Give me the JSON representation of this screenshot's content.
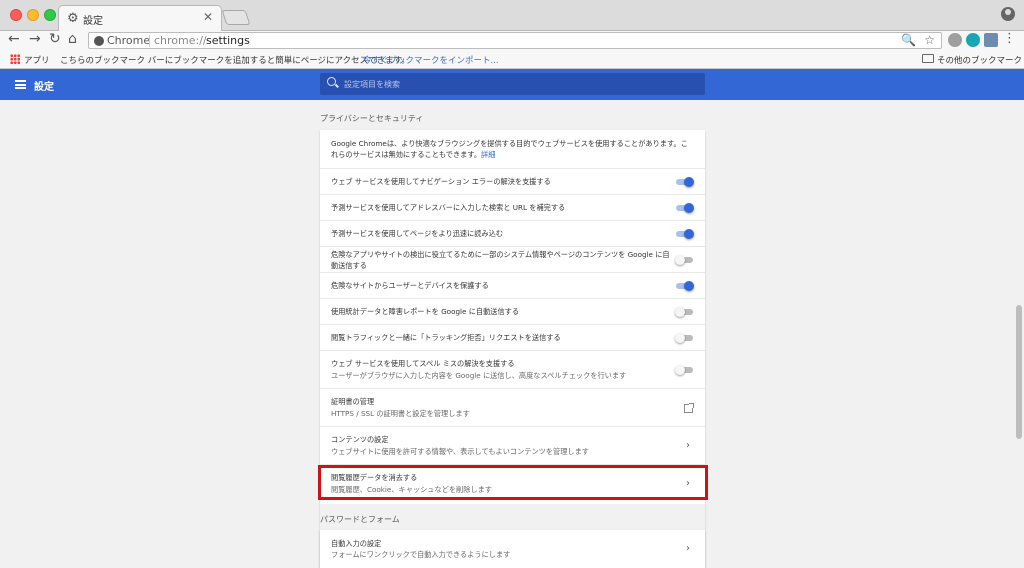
{
  "browser": {
    "tab_title": "設定",
    "tab_close": "✕",
    "site_name": "Chrome",
    "url_scheme": "chrome://",
    "url_path": "settings"
  },
  "bookmarks": {
    "apps_label": "アプリ",
    "hint": "こちらのブックマーク バーにブックマークを追加すると簡単にページにアクセスできます。",
    "import_link": "今すぐブックマークをインポート...",
    "other_bookmarks": "その他のブックマーク"
  },
  "header": {
    "title": "設定",
    "search_placeholder": "設定項目を検索"
  },
  "privacy": {
    "section_title": "プライバシーとセキュリティ",
    "intro": "Google Chromeは、より快適なブラウジングを提供する目的でウェブサービスを使用することがあります。これらのサービスは無効にすることもできます。",
    "intro_link": "詳細",
    "rows": [
      {
        "label": "ウェブ サービスを使用してナビゲーション エラーの解決を支援する",
        "on": true
      },
      {
        "label": "予測サービスを使用してアドレスバーに入力した検索と URL を補完する",
        "on": true
      },
      {
        "label": "予測サービスを使用してページをより迅速に読み込む",
        "on": true
      },
      {
        "label": "危険なアプリやサイトの検出に役立てるために一部のシステム情報やページのコンテンツを Google に自動送信する",
        "on": false
      },
      {
        "label": "危険なサイトからユーザーとデバイスを保護する",
        "on": true
      },
      {
        "label": "使用統計データと障害レポートを Google に自動送信する",
        "on": false
      },
      {
        "label": "閲覧トラフィックと一緒に「トラッキング拒否」リクエストを送信する",
        "on": false
      },
      {
        "label": "ウェブ サービスを使用してスペル ミスの解決を支援する",
        "sub": "ユーザーがブラウザに入力した内容を Google に送信し、高度なスペルチェックを行います",
        "on": false
      }
    ],
    "certificates": {
      "label": "証明書の管理",
      "sub": "HTTPS / SSL の証明書と設定を管理します"
    },
    "content_settings": {
      "label": "コンテンツの設定",
      "sub": "ウェブサイトに使用を許可する情報や、表示してもよいコンテンツを管理します"
    },
    "clear_data": {
      "label": "閲覧履歴データを消去する",
      "sub": "閲覧履歴、Cookie、キャッシュなどを削除します"
    }
  },
  "passwords": {
    "section_title": "パスワードとフォーム",
    "autofill": {
      "label": "自動入力の設定",
      "sub": "フォームにワンクリックで自動入力できるようにします"
    }
  },
  "colors": {
    "accent": "#3367d6",
    "highlight": "#cc1417"
  }
}
